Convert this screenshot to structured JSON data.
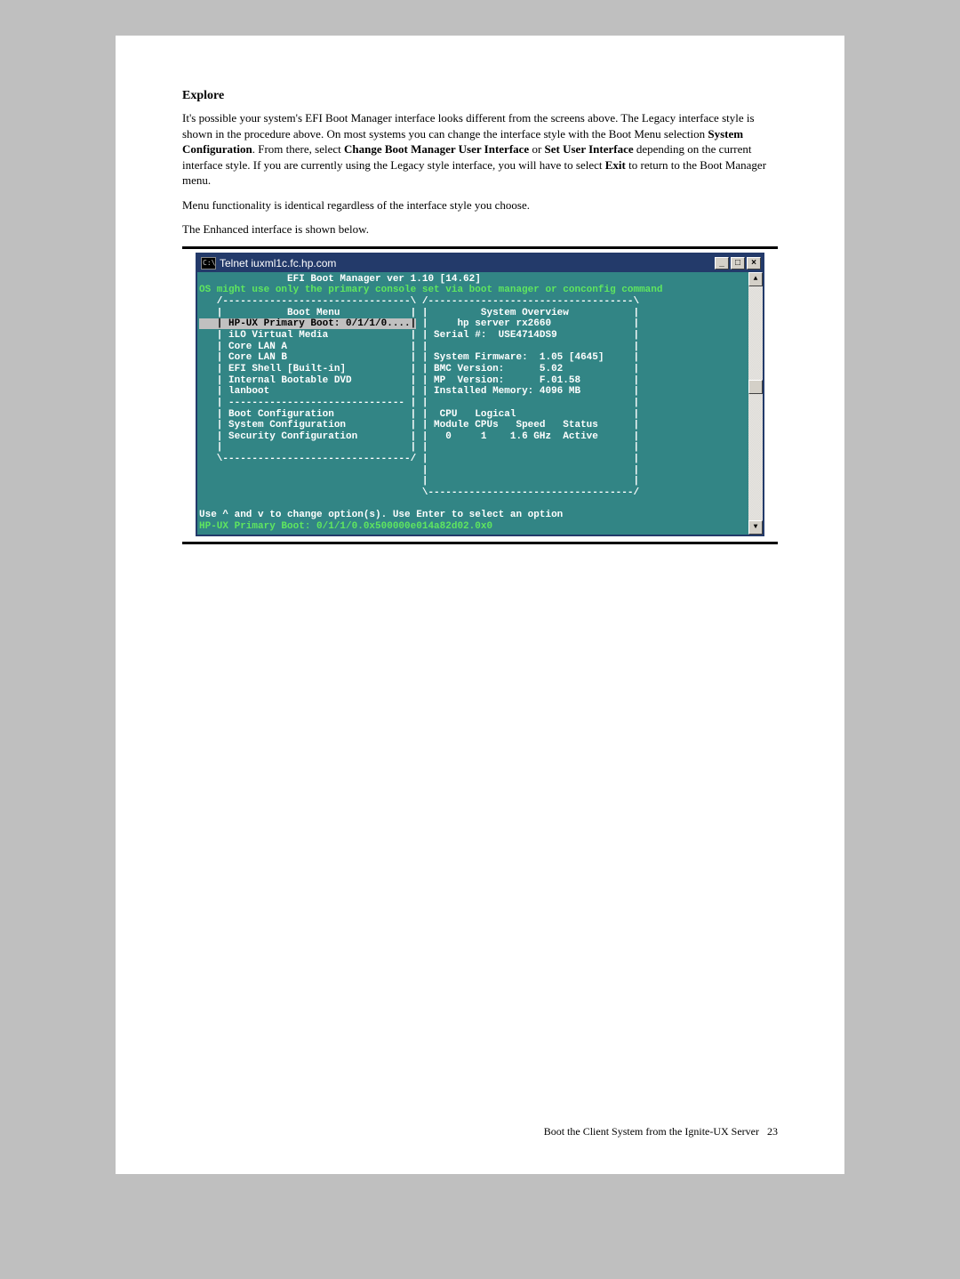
{
  "heading": "Explore",
  "paragraphs": {
    "p1a": "It's possible your system's EFI Boot Manager interface looks different from the screens above. The Legacy interface style is shown in the procedure above. On most systems you can change the interface style with the Boot Menu selection ",
    "b1": "System Configuration",
    "p1b": ". From there, select ",
    "b2": "Change Boot Manager User Interface",
    "p1c": " or ",
    "b3": "Set User Interface",
    "p1d": " depending on the current interface style. If you are currently using the Legacy style interface, you will have to select ",
    "b4": "Exit",
    "p1e": " to return to the Boot Manager menu.",
    "p2": "Menu functionality is identical regardless of the interface style you choose.",
    "p3": "The Enhanced interface is shown below."
  },
  "terminal": {
    "titlebar_icon_text": "C:\\",
    "title": "Telnet iuxml1c.fc.hp.com",
    "minimize": "_",
    "maximize": "□",
    "close": "×",
    "scroll_up": "▲",
    "scroll_down": "▼",
    "header_line1": "               EFI Boot Manager ver 1.10 [14.62]",
    "header_line2": "OS might use only the primary console set via boot manager or conconfig command",
    "left_top": "   /--------------------------------\\",
    "left_title": "   |           Boot Menu            |",
    "left_sel": "   | HP-UX Primary Boot: 0/1/1/0....|",
    "left_l1": "   | iLO Virtual Media              |",
    "left_l2": "   | Core LAN A                     |",
    "left_l3": "   | Core LAN B                     |",
    "left_l4": "   | EFI Shell [Built-in]           |",
    "left_l5": "   | Internal Bootable DVD          |",
    "left_l6": "   | lanboot                        |",
    "left_l7": "   | ------------------------------ |",
    "left_l8": "   | Boot Configuration             |",
    "left_l9": "   | System Configuration           |",
    "left_l10": "   | Security Configuration         |",
    "left_blank": "   |                                |",
    "left_bot": "   \\--------------------------------/",
    "right_top": " /-----------------------------------\\",
    "right_l1": " |         System Overview           |",
    "right_l2": " |     hp server rx2660              |",
    "right_l3": " | Serial #:  USE4714DS9             |",
    "right_l4": " |                                   |",
    "right_l5": " | System Firmware:  1.05 [4645]     |",
    "right_l6": " | BMC Version:      5.02            |",
    "right_l7": " | MP  Version:      F.01.58         |",
    "right_l8": " | Installed Memory: 4096 MB         |",
    "right_l9": " |                                   |",
    "right_l10": " |  CPU   Logical                    |",
    "right_l11": " | Module CPUs   Speed   Status      |",
    "right_l12": " |   0     1    1.6 GHz  Active      |",
    "right_blank": " |                                   |",
    "right_bot": " \\-----------------------------------/",
    "hint": "Use ^ and v to change option(s). Use Enter to select an option",
    "status": "HP-UX Primary Boot: 0/1/1/0.0x500000e014a82d02.0x0"
  },
  "footer": {
    "text": "Boot the Client System from the Ignite-UX Server",
    "page": "23"
  }
}
